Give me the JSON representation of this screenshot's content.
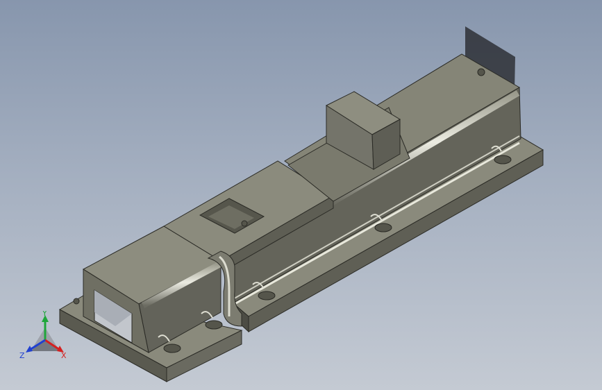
{
  "viewport": {
    "background_top": "#8796ad",
    "background_bottom": "#c4cad3"
  },
  "model": {
    "colors": {
      "top": "#8a8a7c",
      "front": "#65655a",
      "side": "#74746a",
      "dark": "#3e3e38",
      "edge": "#2a2a25",
      "highlight": "#e4e4d8",
      "hole": "#55554b",
      "shadow": "#2f3137"
    }
  },
  "triad": {
    "x_label": "X",
    "y_label": "Y",
    "z_label": "Z",
    "x_color": "#d42020",
    "y_color": "#1fa63a",
    "z_color": "#2040d0"
  }
}
